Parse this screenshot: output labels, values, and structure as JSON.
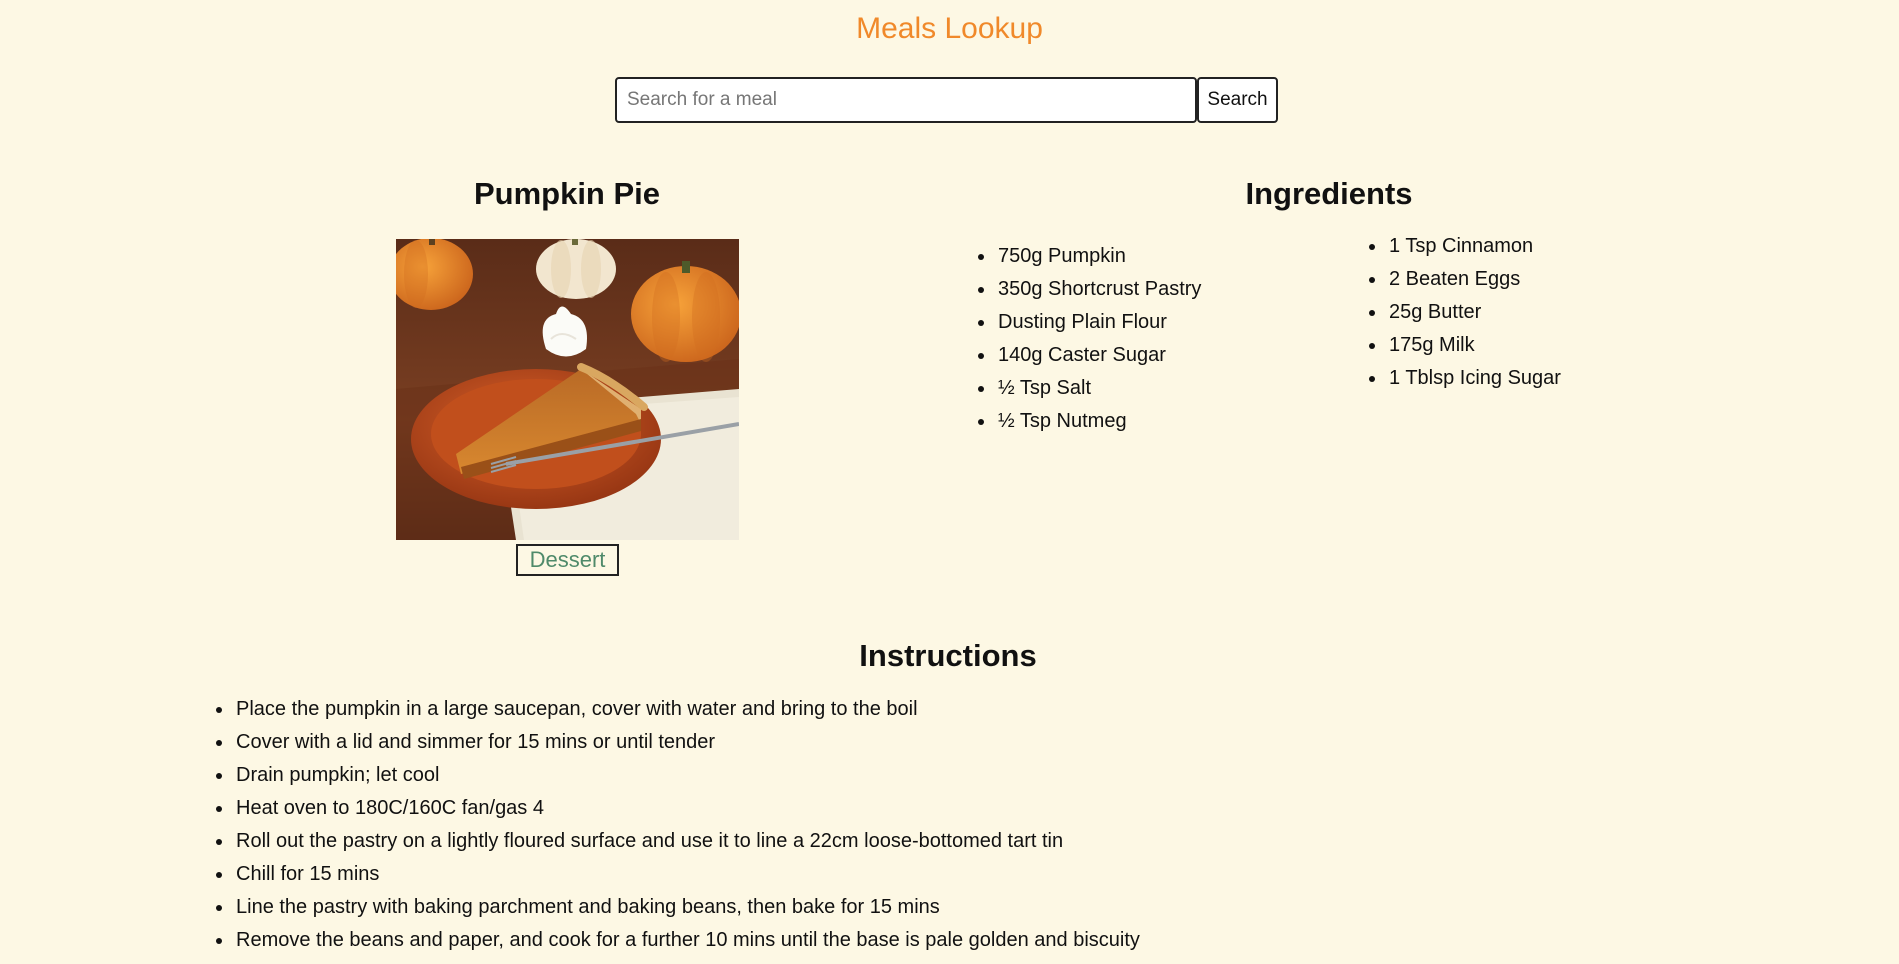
{
  "header": {
    "title": "Meals Lookup"
  },
  "search": {
    "placeholder": "Search for a meal",
    "value": "",
    "button_label": "Search"
  },
  "meal": {
    "name": "Pumpkin Pie",
    "image_alt": "Slice of pumpkin pie with whipped cream on an orange plate with pumpkins",
    "category": "Dessert"
  },
  "ingredients": {
    "heading": "Ingredients",
    "column1": [
      "750g Pumpkin",
      "350g Shortcrust Pastry",
      "Dusting Plain Flour",
      "140g Caster Sugar",
      "½ Tsp Salt",
      "½ Tsp Nutmeg"
    ],
    "column2": [
      "1 Tsp Cinnamon",
      "2 Beaten Eggs",
      "25g Butter",
      "175g Milk",
      "1 Tblsp Icing Sugar"
    ]
  },
  "instructions": {
    "heading": "Instructions",
    "steps": [
      "Place the pumpkin in a large saucepan, cover with water and bring to the boil",
      "Cover with a lid and simmer for 15 mins or until tender",
      "Drain pumpkin; let cool",
      "Heat oven to 180C/160C fan/gas 4",
      "Roll out the pastry on a lightly floured surface and use it to line a 22cm loose-bottomed tart tin",
      "Chill for 15 mins",
      "Line the pastry with baking parchment and baking beans, then bake for 15 mins",
      "Remove the beans and paper, and cook for a further 10 mins until the base is pale golden and biscuity"
    ]
  },
  "colors": {
    "background": "#fdf8e4",
    "title_accent": "#f0892a",
    "category_text": "#4f8a6a"
  }
}
